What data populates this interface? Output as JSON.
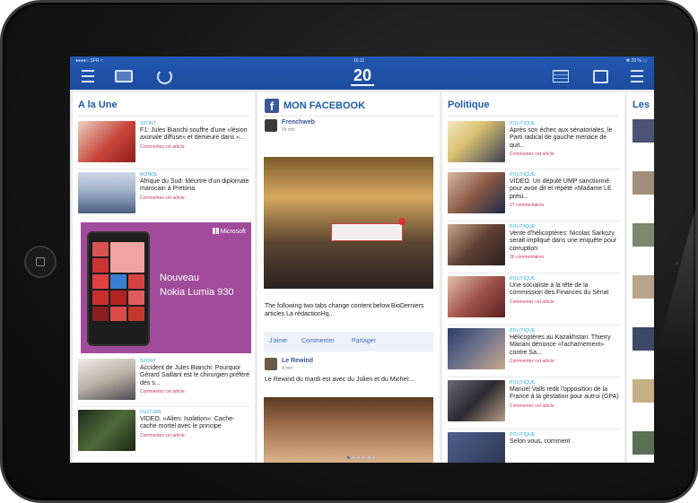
{
  "status_bar": {
    "carrier": "●●●●○ SFR ≈",
    "time": "16:11",
    "battery": "✱ 29 % ▭"
  },
  "toolbar": {
    "logo": "20"
  },
  "colors": {
    "brand_blue": "#1f5aa8",
    "facebook_blue": "#3b5998",
    "category_cyan": "#29a7d8",
    "comment_pink": "#c73866",
    "ad_purple": "#a04c9a"
  },
  "icons": [
    "hamburger-menu-icon",
    "tile-view-icon",
    "refresh-icon",
    "grid-icon",
    "share-icon"
  ],
  "columns": {
    "alaune": {
      "title": "A la Une",
      "articles": [
        {
          "category": "SPORT",
          "title": "F1: Jules Bianchi souffre d'une «lésion axonale diffuse» et demeure dans «...",
          "comment": "Commentez cet article"
        },
        {
          "category": "MONDE",
          "title": "Afrique du Sud: Meurtre d'un diplomate marocain à Pretoria",
          "comment": "Commentez cet article"
        },
        {
          "category": "SPORT",
          "title": "Accident de Jules Bianchi: Pourquoi Gérard Saillant est le chirurgien préféré des s...",
          "comment": "Commentez cet article"
        },
        {
          "category": "CULTURE",
          "title": "VIDEO. «Alien: Isolation»: Cache-cache mortel avec le principe",
          "comment": "Commentez cet article"
        }
      ],
      "ad": {
        "brand": "Microsoft",
        "line1": "Nouveau",
        "line2": "Nokia Lumia 930"
      }
    },
    "facebook": {
      "title": "MON FACEBOOK",
      "post1": {
        "author": "Frenchweb",
        "time": "5h min",
        "text": "The following two tabs change content below.BioDerniers articles La rédactionHq..."
      },
      "actions": {
        "like": "J'aime",
        "comment": "Commenter",
        "share": "Partager"
      },
      "post2": {
        "author": "Le Rewind",
        "time": "4 min",
        "text": "Le Rewind du mardi est avec du Julien et du Michel:..."
      }
    },
    "politique": {
      "title": "Politique",
      "articles": [
        {
          "category": "POLITIQUE",
          "title": "Après son échec aux sénatoriales, le Parti radical de gauche menace de quit...",
          "comment": "Commentez cet article"
        },
        {
          "category": "POLITIQUE",
          "title": "VIDEO. Un député UMP sanctionné pour avoir dit et répété «Madame LE prési...",
          "comment": "27 commentaires"
        },
        {
          "category": "POLITIQUE",
          "title": "Vente d'hélicoptères: Nicolas Sarkozy serait impliqué dans une enquête pour corruption",
          "comment": "26 commentaires"
        },
        {
          "category": "POLITIQUE",
          "title": "Une socialiste à la tête de la commission des Finances du Sénat",
          "comment": "Commentez cet article"
        },
        {
          "category": "POLITIQUE",
          "title": "Hélicoptères au Kazakhstan: Thierry Mariani dénonce «l'acharnement» contre Sa...",
          "comment": "Commentez cet article"
        },
        {
          "category": "POLITIQUE",
          "title": "Manuel Valls redit l'opposition de la France à la gestation pour autrui (GPA)",
          "comment": "Commentez cet article"
        },
        {
          "category": "POLITIQUE",
          "title": "Selon vous, comment",
          "comment": ""
        }
      ]
    },
    "next": {
      "title": "Les"
    }
  },
  "pagination": {
    "dots": "●●●●●"
  }
}
